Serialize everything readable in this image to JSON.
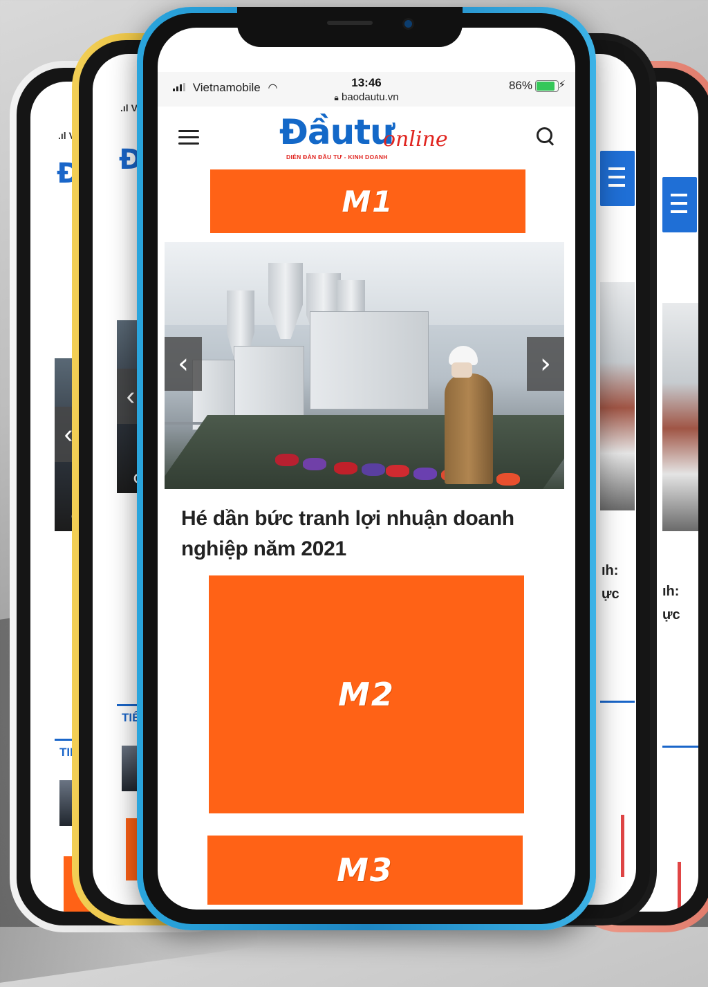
{
  "status_bar": {
    "carrier": "Vietnamobile",
    "time": "13:46",
    "url": "baodautu.vn",
    "battery": "86%"
  },
  "header": {
    "logo_main": "Đầutư",
    "logo_online": "online",
    "logo_tagline": "DIỄN ĐÀN ĐẦU TƯ - KINH DOANH"
  },
  "ads": {
    "m1": "M1",
    "m2": "M2",
    "m3": "M3"
  },
  "article": {
    "headline": "Hé dần bức tranh lợi nhuận doanh nghiệp năm 2021"
  },
  "background_phones": {
    "left_carrier_partial": "V",
    "logo_partial": "Đ",
    "section_tag_partial": "TIÊU",
    "right_text_line1": "ıh:",
    "right_text_line2": "ực",
    "left_caption_partial": "Q"
  },
  "colors": {
    "accent_orange": "#ff6216",
    "brand_blue": "#1368c8",
    "brand_red": "#e0241f",
    "frame_blue": "#2aa5dd",
    "frame_yellow": "#f2cf55",
    "frame_coral": "#f0a08f"
  },
  "icons": [
    "menu-icon",
    "search-icon",
    "lock-icon",
    "wifi-icon",
    "signal-icon",
    "battery-icon",
    "chevron-left-icon",
    "chevron-right-icon"
  ]
}
